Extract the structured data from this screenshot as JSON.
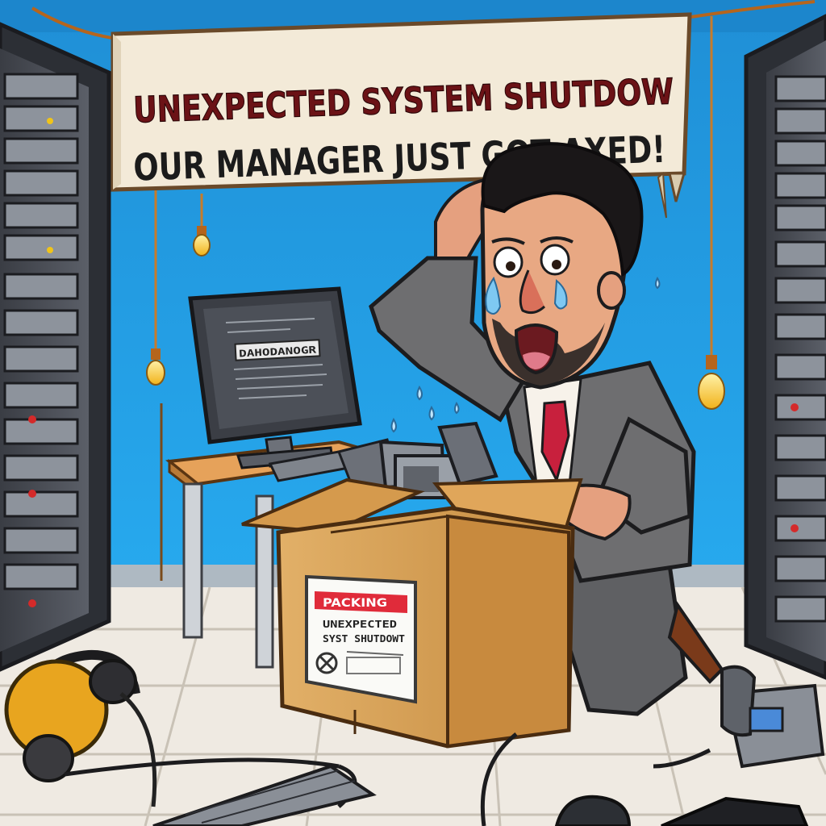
{
  "banner": {
    "line1": "UNEXPECTED SYSTEM SHUTDOW",
    "line2": "OUR MANAGER JUST GOT AXED!"
  },
  "monitor": {
    "label": "DAHODANOGR"
  },
  "box_label": {
    "tag": "PACKING",
    "line1": "UNEXPECTED",
    "line2": "SYST SHUTDOWT"
  },
  "colors": {
    "wall": "#1e9be0",
    "banner_cloth": "#f3ead8",
    "banner_text_line1": "#6b1216",
    "banner_text_line2": "#1b1b1b",
    "box": "#d9a455",
    "suit": "#6e6e70",
    "tie": "#c8203d",
    "floor": "#f1ede6"
  }
}
